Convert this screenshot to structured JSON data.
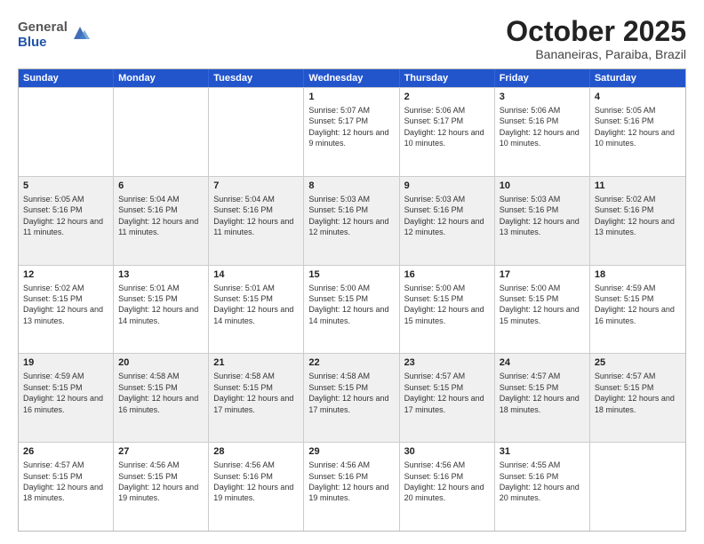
{
  "header": {
    "logo_general": "General",
    "logo_blue": "Blue",
    "month_title": "October 2025",
    "location": "Bananeiras, Paraiba, Brazil"
  },
  "weekdays": [
    "Sunday",
    "Monday",
    "Tuesday",
    "Wednesday",
    "Thursday",
    "Friday",
    "Saturday"
  ],
  "rows": [
    [
      {
        "day": "",
        "text": ""
      },
      {
        "day": "",
        "text": ""
      },
      {
        "day": "",
        "text": ""
      },
      {
        "day": "1",
        "text": "Sunrise: 5:07 AM\nSunset: 5:17 PM\nDaylight: 12 hours and 9 minutes."
      },
      {
        "day": "2",
        "text": "Sunrise: 5:06 AM\nSunset: 5:17 PM\nDaylight: 12 hours and 10 minutes."
      },
      {
        "day": "3",
        "text": "Sunrise: 5:06 AM\nSunset: 5:16 PM\nDaylight: 12 hours and 10 minutes."
      },
      {
        "day": "4",
        "text": "Sunrise: 5:05 AM\nSunset: 5:16 PM\nDaylight: 12 hours and 10 minutes."
      }
    ],
    [
      {
        "day": "5",
        "text": "Sunrise: 5:05 AM\nSunset: 5:16 PM\nDaylight: 12 hours and 11 minutes."
      },
      {
        "day": "6",
        "text": "Sunrise: 5:04 AM\nSunset: 5:16 PM\nDaylight: 12 hours and 11 minutes."
      },
      {
        "day": "7",
        "text": "Sunrise: 5:04 AM\nSunset: 5:16 PM\nDaylight: 12 hours and 11 minutes."
      },
      {
        "day": "8",
        "text": "Sunrise: 5:03 AM\nSunset: 5:16 PM\nDaylight: 12 hours and 12 minutes."
      },
      {
        "day": "9",
        "text": "Sunrise: 5:03 AM\nSunset: 5:16 PM\nDaylight: 12 hours and 12 minutes."
      },
      {
        "day": "10",
        "text": "Sunrise: 5:03 AM\nSunset: 5:16 PM\nDaylight: 12 hours and 13 minutes."
      },
      {
        "day": "11",
        "text": "Sunrise: 5:02 AM\nSunset: 5:16 PM\nDaylight: 12 hours and 13 minutes."
      }
    ],
    [
      {
        "day": "12",
        "text": "Sunrise: 5:02 AM\nSunset: 5:15 PM\nDaylight: 12 hours and 13 minutes."
      },
      {
        "day": "13",
        "text": "Sunrise: 5:01 AM\nSunset: 5:15 PM\nDaylight: 12 hours and 14 minutes."
      },
      {
        "day": "14",
        "text": "Sunrise: 5:01 AM\nSunset: 5:15 PM\nDaylight: 12 hours and 14 minutes."
      },
      {
        "day": "15",
        "text": "Sunrise: 5:00 AM\nSunset: 5:15 PM\nDaylight: 12 hours and 14 minutes."
      },
      {
        "day": "16",
        "text": "Sunrise: 5:00 AM\nSunset: 5:15 PM\nDaylight: 12 hours and 15 minutes."
      },
      {
        "day": "17",
        "text": "Sunrise: 5:00 AM\nSunset: 5:15 PM\nDaylight: 12 hours and 15 minutes."
      },
      {
        "day": "18",
        "text": "Sunrise: 4:59 AM\nSunset: 5:15 PM\nDaylight: 12 hours and 16 minutes."
      }
    ],
    [
      {
        "day": "19",
        "text": "Sunrise: 4:59 AM\nSunset: 5:15 PM\nDaylight: 12 hours and 16 minutes."
      },
      {
        "day": "20",
        "text": "Sunrise: 4:58 AM\nSunset: 5:15 PM\nDaylight: 12 hours and 16 minutes."
      },
      {
        "day": "21",
        "text": "Sunrise: 4:58 AM\nSunset: 5:15 PM\nDaylight: 12 hours and 17 minutes."
      },
      {
        "day": "22",
        "text": "Sunrise: 4:58 AM\nSunset: 5:15 PM\nDaylight: 12 hours and 17 minutes."
      },
      {
        "day": "23",
        "text": "Sunrise: 4:57 AM\nSunset: 5:15 PM\nDaylight: 12 hours and 17 minutes."
      },
      {
        "day": "24",
        "text": "Sunrise: 4:57 AM\nSunset: 5:15 PM\nDaylight: 12 hours and 18 minutes."
      },
      {
        "day": "25",
        "text": "Sunrise: 4:57 AM\nSunset: 5:15 PM\nDaylight: 12 hours and 18 minutes."
      }
    ],
    [
      {
        "day": "26",
        "text": "Sunrise: 4:57 AM\nSunset: 5:15 PM\nDaylight: 12 hours and 18 minutes."
      },
      {
        "day": "27",
        "text": "Sunrise: 4:56 AM\nSunset: 5:15 PM\nDaylight: 12 hours and 19 minutes."
      },
      {
        "day": "28",
        "text": "Sunrise: 4:56 AM\nSunset: 5:16 PM\nDaylight: 12 hours and 19 minutes."
      },
      {
        "day": "29",
        "text": "Sunrise: 4:56 AM\nSunset: 5:16 PM\nDaylight: 12 hours and 19 minutes."
      },
      {
        "day": "30",
        "text": "Sunrise: 4:56 AM\nSunset: 5:16 PM\nDaylight: 12 hours and 20 minutes."
      },
      {
        "day": "31",
        "text": "Sunrise: 4:55 AM\nSunset: 5:16 PM\nDaylight: 12 hours and 20 minutes."
      },
      {
        "day": "",
        "text": ""
      }
    ]
  ]
}
